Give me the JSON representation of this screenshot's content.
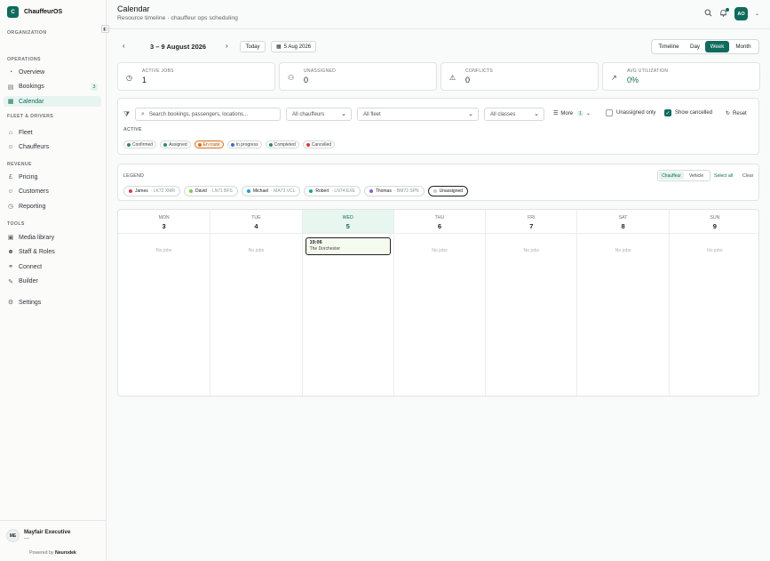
{
  "app": {
    "name": "ChauffeurOS",
    "logo_letter": "C"
  },
  "sidebar": {
    "org_label": "ORGANIZATION",
    "sections": [
      {
        "label": "OPERATIONS",
        "items": [
          {
            "label": "Overview",
            "icon": "gauge-icon"
          },
          {
            "label": "Bookings",
            "icon": "book-icon",
            "badge": "3"
          },
          {
            "label": "Calendar",
            "icon": "calendar-icon",
            "active": true
          }
        ]
      },
      {
        "label": "FLEET & DRIVERS",
        "items": [
          {
            "label": "Fleet",
            "icon": "car-icon"
          },
          {
            "label": "Chauffeurs",
            "icon": "users-icon"
          }
        ]
      },
      {
        "label": "REVENUE",
        "items": [
          {
            "label": "Pricing",
            "icon": "pound-icon"
          },
          {
            "label": "Customers",
            "icon": "user-icon"
          },
          {
            "label": "Reporting",
            "icon": "chart-icon"
          }
        ]
      },
      {
        "label": "TOOLS",
        "items": [
          {
            "label": "Media library",
            "icon": "image-icon"
          },
          {
            "label": "Staff & Roles",
            "icon": "team-icon"
          },
          {
            "label": "Connect",
            "icon": "link-icon"
          },
          {
            "label": "Builder",
            "icon": "builder-icon"
          }
        ]
      }
    ],
    "settings_label": "Settings",
    "account": {
      "initials": "ME",
      "name": "Mayfair Executive",
      "sub": "—"
    },
    "powered_prefix": "Powered by",
    "powered_brand": "Neurodek"
  },
  "header": {
    "title": "Calendar",
    "subtitle": "Resource timeline · chauffeur ops scheduling",
    "user_initials": "AO"
  },
  "toolbar": {
    "range": "3 – 9 August 2026",
    "today_label": "Today",
    "date_label": "5 Aug 2026",
    "views": [
      "Timeline",
      "Day",
      "Week",
      "Month"
    ],
    "active_view": "Week"
  },
  "stats": [
    {
      "label": "ACTIVE JOBS",
      "value": "1",
      "icon": "clock-icon"
    },
    {
      "label": "UNASSIGNED",
      "value": "0",
      "icon": "user-plus-icon"
    },
    {
      "label": "CONFLICTS",
      "value": "0",
      "icon": "warning-icon"
    },
    {
      "label": "AVG UTILIZATION",
      "value": "0%",
      "icon": "trend-icon"
    }
  ],
  "filters": {
    "search_placeholder": "Search bookings, passengers, locations...",
    "chauffeurs": "All chauffeurs",
    "fleet": "All fleet",
    "classes": "All classes",
    "more_label": "More",
    "more_count": "1",
    "unassigned_only": "Unassigned only",
    "show_cancelled": "Show cancelled",
    "reset": "Reset",
    "active_label": "ACTIVE",
    "statuses": [
      {
        "label": "Confirmed",
        "color": "#2f8a6b"
      },
      {
        "label": "Assigned",
        "color": "#2f8a6b"
      },
      {
        "label": "En route",
        "color": "#d2762b",
        "selected": true
      },
      {
        "label": "In progress",
        "color": "#3a6fcf"
      },
      {
        "label": "Completed",
        "color": "#2f8a6b"
      },
      {
        "label": "Cancelled",
        "color": "#d23c3c"
      }
    ]
  },
  "legend": {
    "title": "LEGEND",
    "modes": [
      "Chauffeur",
      "Vehicle"
    ],
    "active_mode": "Chauffeur",
    "select_all": "Select all",
    "clear": "Clear",
    "chauffeurs": [
      {
        "name": "James",
        "plate": "· LK72 XMR",
        "color": "#e0344c"
      },
      {
        "name": "David",
        "plate": "· LN71 BFS",
        "color": "#7ac943"
      },
      {
        "name": "Michael",
        "plate": "· MA73 VCL",
        "color": "#1b9ad6"
      },
      {
        "name": "Robert",
        "plate": "· LN74 EXE",
        "color": "#1aa58a"
      },
      {
        "name": "Thomas",
        "plate": "· BM72 SPN",
        "color": "#8c5bd8"
      },
      {
        "name": "Unassigned",
        "plate": "",
        "color": "#c7cbcc",
        "selected": true
      }
    ]
  },
  "calendar": {
    "no_jobs": "No jobs",
    "days": [
      {
        "name": "MON",
        "num": "3"
      },
      {
        "name": "TUE",
        "num": "4"
      },
      {
        "name": "WED",
        "num": "5",
        "today": true,
        "job": {
          "time": "19:06",
          "location": "The Dorchester"
        }
      },
      {
        "name": "THU",
        "num": "6"
      },
      {
        "name": "FRI",
        "num": "7"
      },
      {
        "name": "SAT",
        "num": "8"
      },
      {
        "name": "SUN",
        "num": "9"
      }
    ]
  }
}
